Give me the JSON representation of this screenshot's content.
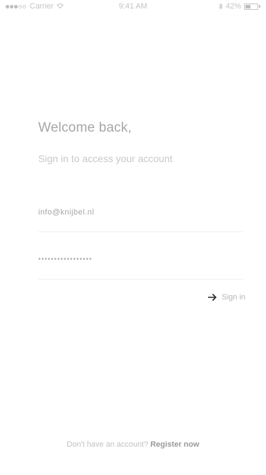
{
  "status_bar": {
    "carrier": "Carrier",
    "time": "9:41 AM",
    "battery_percent": "42%",
    "battery_level": 0.42,
    "signal_bars_on": 3,
    "signal_bars_total": 5
  },
  "login": {
    "title": "Welcome back,",
    "subtitle": "Sign in to access your account",
    "email_value": "info@knijbel.nl",
    "password_value": "•••••••••••••••••",
    "sign_in_label": "Sign in"
  },
  "footer": {
    "prompt": "Don't have an account?",
    "register_label": "Register now"
  },
  "colors": {
    "text_primary": "#a6a6a6",
    "text_muted": "#c8c8c8",
    "divider": "#efefef"
  },
  "icons": {
    "sign_in": "arrow-right-icon",
    "wifi": "wifi-icon",
    "bluetooth": "bluetooth-icon",
    "battery": "battery-icon"
  }
}
